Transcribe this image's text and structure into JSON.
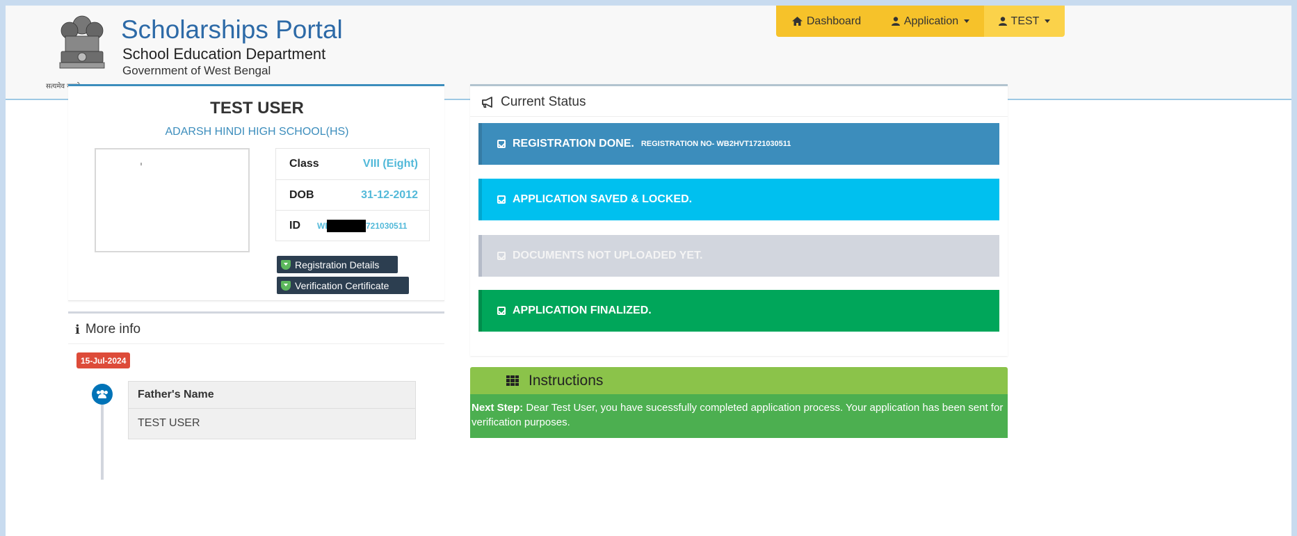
{
  "header": {
    "title": "Scholarships Portal",
    "subtitle": "School Education Department",
    "subtitle2": "Government of West Bengal",
    "emblem_motto": "सत्यमेव जयते"
  },
  "nav": {
    "dashboard": "Dashboard",
    "application": "Application",
    "user": "TEST"
  },
  "profile": {
    "name": "TEST USER",
    "school": "ADARSH HINDI HIGH SCHOOL(HS)",
    "class_label": "Class",
    "class_value": "VIII (Eight)",
    "dob_label": "DOB",
    "dob_value": "31-12-2012",
    "id_label": "ID",
    "id_prefix": "WE",
    "id_suffix": "721030511",
    "btn_registration": "Registration Details",
    "btn_verification": "Verification Certificate"
  },
  "more_info": {
    "heading": "More info",
    "date": "15-Jul-2024",
    "field_label": "Father's Name",
    "field_value": "TEST USER"
  },
  "status": {
    "heading": "Current Status",
    "items": [
      {
        "text": "REGISTRATION DONE.",
        "detail": "REGISTRATION NO- WB2HVT1721030511"
      },
      {
        "text": "APPLICATION SAVED & LOCKED.",
        "detail": ""
      },
      {
        "text": "DOCUMENTS NOT UPLOADED YET.",
        "detail": ""
      },
      {
        "text": "APPLICATION FINALIZED.",
        "detail": ""
      }
    ]
  },
  "instructions": {
    "heading": "Instructions",
    "lead": "Next Step:",
    "body": "Dear Test User, you have sucessfully completed application process. Your application has been sent for verification purposes."
  },
  "colors": {
    "primary": "#3c8dbc",
    "info": "#00c0ef",
    "muted": "#d2d6de",
    "success": "#00a65a",
    "warning": "#f6c22a",
    "danger": "#dd4b39"
  }
}
